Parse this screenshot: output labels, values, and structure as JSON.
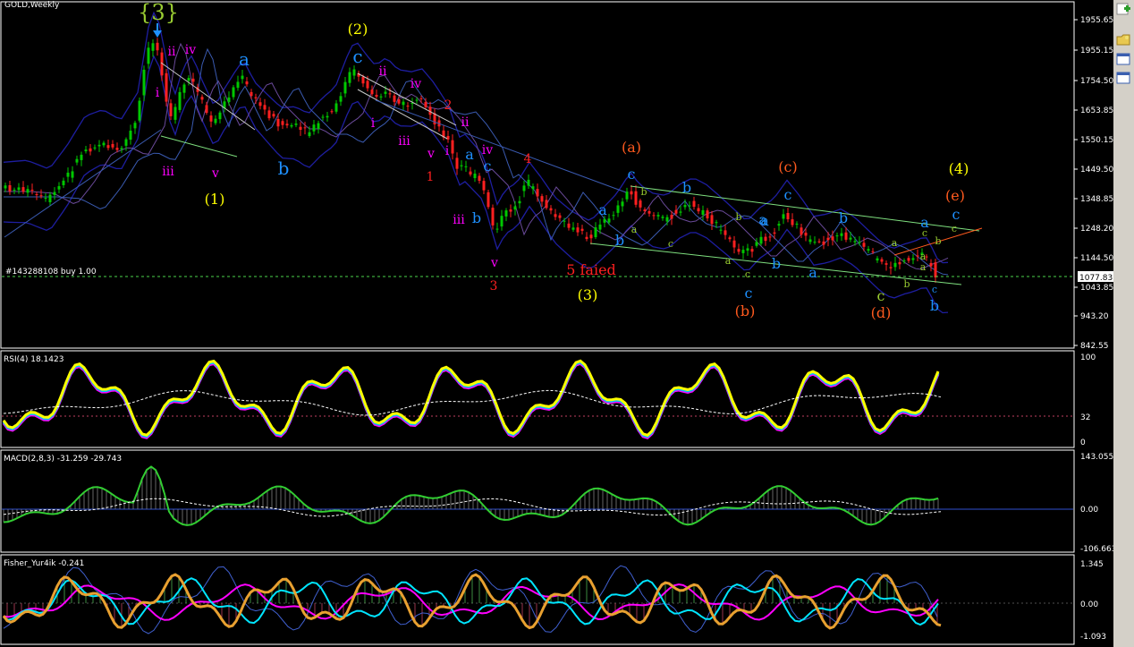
{
  "window": {
    "title": "GOLD,Weekly"
  },
  "price_panel": {
    "order_label": "#143288108 buy 1.00",
    "current_price": "1077.83",
    "axis_ticks": [
      "1955.65",
      "1955.15",
      "1754.50",
      "1653.85",
      "1550.15",
      "1449.50",
      "1348.85",
      "1248.20",
      "1144.50",
      "1043.85",
      "943.20",
      "842.55"
    ]
  },
  "rsi_panel": {
    "title": "RSI(4) 18.1423",
    "axis_ticks": [
      "100",
      "32",
      "0"
    ]
  },
  "macd_panel": {
    "title": "MACD(2,8,3) -31.259 -29.743",
    "axis_ticks": [
      "143.055",
      "0.00",
      "-106.663"
    ]
  },
  "fisher_panel": {
    "title": "Fisher_Yur4ik -0.241",
    "axis_ticks": [
      "1.345",
      "0.00",
      "-1.093"
    ]
  },
  "wave_labels": [
    {
      "text": "{3}",
      "color": "#9acd32"
    },
    {
      "text": "(2)",
      "color": "#ffff00"
    },
    {
      "text": "(1)",
      "color": "#ffff00"
    },
    {
      "text": "(3)",
      "color": "#ffff00"
    },
    {
      "text": "(4)",
      "color": "#ffff00"
    },
    {
      "text": "(a)",
      "color": "#ff5a1e"
    },
    {
      "text": "(b)",
      "color": "#ff5a1e"
    },
    {
      "text": "(c)",
      "color": "#ff5a1e"
    },
    {
      "text": "(d)",
      "color": "#ff5a1e"
    },
    {
      "text": "(e)",
      "color": "#ff5a1e"
    },
    {
      "text": "ii",
      "color": "#ff00ff"
    },
    {
      "text": "iv",
      "color": "#ff00ff"
    },
    {
      "text": "i",
      "color": "#ff00ff"
    },
    {
      "text": "iii",
      "color": "#ff00ff"
    },
    {
      "text": "v",
      "color": "#ff00ff"
    },
    {
      "text": "a",
      "color": "#1e90ff"
    },
    {
      "text": "b",
      "color": "#1e90ff"
    },
    {
      "text": "c",
      "color": "#1e90ff"
    },
    {
      "text": "ii",
      "color": "#ff00ff"
    },
    {
      "text": "iv",
      "color": "#ff00ff"
    },
    {
      "text": "i",
      "color": "#ff00ff"
    },
    {
      "text": "iii",
      "color": "#ff00ff"
    },
    {
      "text": "v",
      "color": "#ff00ff"
    },
    {
      "text": "2",
      "color": "#ff2020"
    },
    {
      "text": "1",
      "color": "#ff2020"
    },
    {
      "text": "ii",
      "color": "#ff00ff"
    },
    {
      "text": "iv",
      "color": "#ff00ff"
    },
    {
      "text": "i",
      "color": "#ff00ff"
    },
    {
      "text": "iii",
      "color": "#ff00ff"
    },
    {
      "text": "v",
      "color": "#ff00ff"
    },
    {
      "text": "3",
      "color": "#ff2020"
    },
    {
      "text": "4",
      "color": "#ff2020"
    },
    {
      "text": "a",
      "color": "#1e90ff"
    },
    {
      "text": "b",
      "color": "#1e90ff"
    },
    {
      "text": "c",
      "color": "#1e90ff"
    },
    {
      "text": "5 faied",
      "color": "#ff2020"
    },
    {
      "text": "c",
      "color": "#1e90ff"
    },
    {
      "text": "a",
      "color": "#1e90ff"
    },
    {
      "text": "b",
      "color": "#1e90ff"
    },
    {
      "text": "b",
      "color": "#9acd32"
    },
    {
      "text": "a",
      "color": "#9acd32"
    },
    {
      "text": "c",
      "color": "#9acd32"
    },
    {
      "text": "b",
      "color": "#1e90ff"
    },
    {
      "text": "a",
      "color": "#1e90ff"
    },
    {
      "text": "b",
      "color": "#9acd32"
    },
    {
      "text": "a",
      "color": "#9acd32"
    },
    {
      "text": "c",
      "color": "#9acd32"
    },
    {
      "text": "c",
      "color": "#1e90ff"
    },
    {
      "text": "a",
      "color": "#1e90ff"
    },
    {
      "text": "b",
      "color": "#1e90ff"
    },
    {
      "text": "c",
      "color": "#1e90ff"
    },
    {
      "text": "b",
      "color": "#1e90ff"
    },
    {
      "text": "a",
      "color": "#1e90ff"
    },
    {
      "text": "a",
      "color": "#9acd32"
    },
    {
      "text": "c",
      "color": "#9acd32"
    },
    {
      "text": "b",
      "color": "#9acd32"
    },
    {
      "text": "a",
      "color": "#9acd32"
    },
    {
      "text": "c",
      "color": "#9acd32"
    },
    {
      "text": "c",
      "color": "#1e90ff"
    },
    {
      "text": "a",
      "color": "#1e90ff"
    },
    {
      "text": "c",
      "color": "#1e90ff"
    },
    {
      "text": "b",
      "color": "#1e90ff"
    },
    {
      "text": "b",
      "color": "#9acd32"
    },
    {
      "text": "c",
      "color": "#9acd32"
    },
    {
      "text": "a",
      "color": "#9acd32"
    }
  ],
  "colors": {
    "bull_candle": "#00c800",
    "bear_candle": "#ff2020",
    "bands": "#1e1ea0",
    "rsi_line": "#ffff00",
    "macd_line": "#32cd32",
    "fisher_fast": "#00e5ff",
    "fisher_slow": "#ff00ff",
    "fisher_main": "#e8a030"
  },
  "toolbar_icons": [
    "add-icon",
    "folder-icon",
    "window-icon",
    "window-icon"
  ]
}
